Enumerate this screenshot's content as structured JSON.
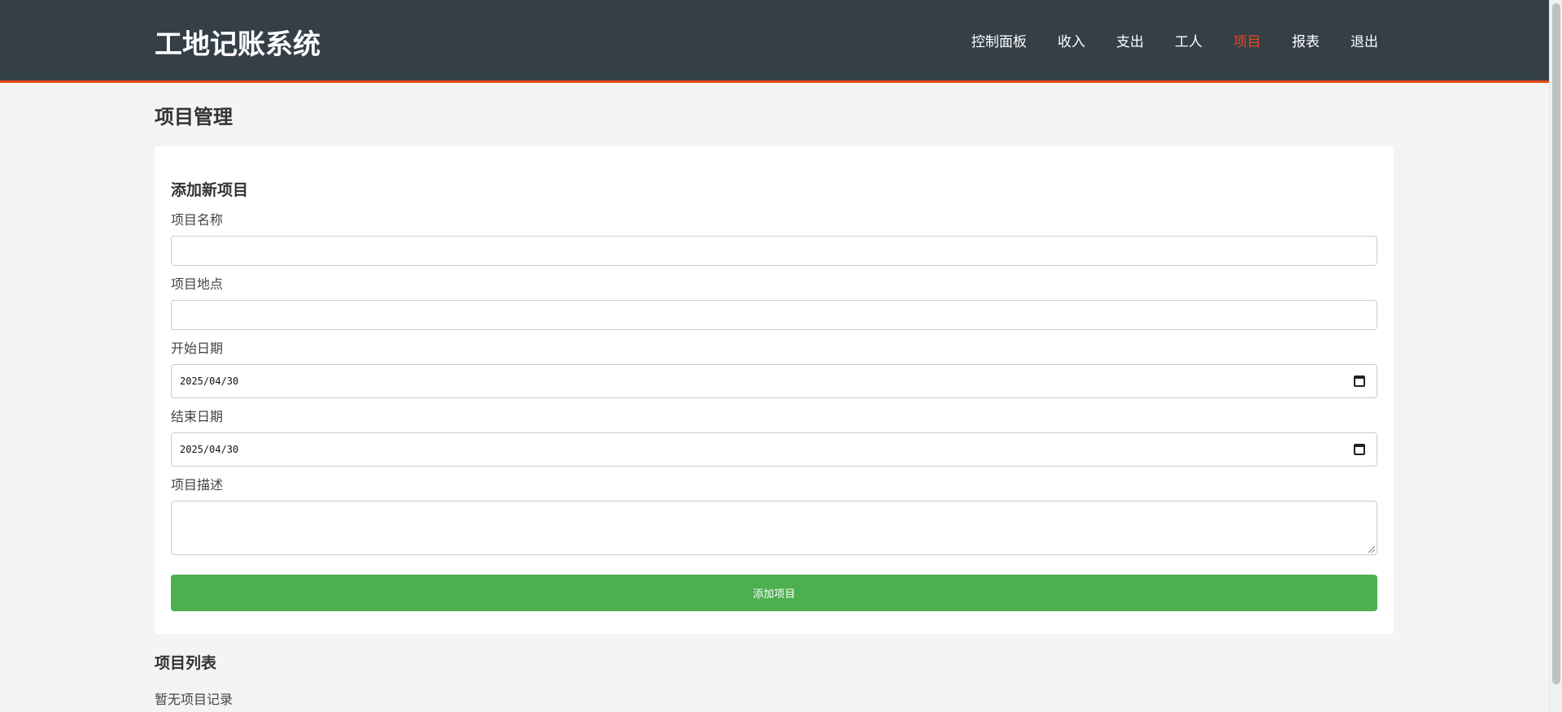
{
  "header": {
    "brand": "工地记账系统",
    "nav": [
      {
        "label": "控制面板",
        "active": false
      },
      {
        "label": "收入",
        "active": false
      },
      {
        "label": "支出",
        "active": false
      },
      {
        "label": "工人",
        "active": false
      },
      {
        "label": "项目",
        "active": true
      },
      {
        "label": "报表",
        "active": false
      },
      {
        "label": "退出",
        "active": false
      }
    ]
  },
  "page": {
    "title": "项目管理"
  },
  "form": {
    "title": "添加新项目",
    "name_label": "项目名称",
    "name_value": "",
    "location_label": "项目地点",
    "location_value": "",
    "start_label": "开始日期",
    "start_value": "2025/04/30",
    "end_label": "结束日期",
    "end_value": "2025/04/30",
    "desc_label": "项目描述",
    "desc_value": "",
    "submit_label": "添加项目"
  },
  "list": {
    "title": "项目列表",
    "empty_text": "暂无项目记录"
  },
  "colors": {
    "header_bg": "#343f48",
    "accent": "#e8491d",
    "button": "#4caf50"
  }
}
